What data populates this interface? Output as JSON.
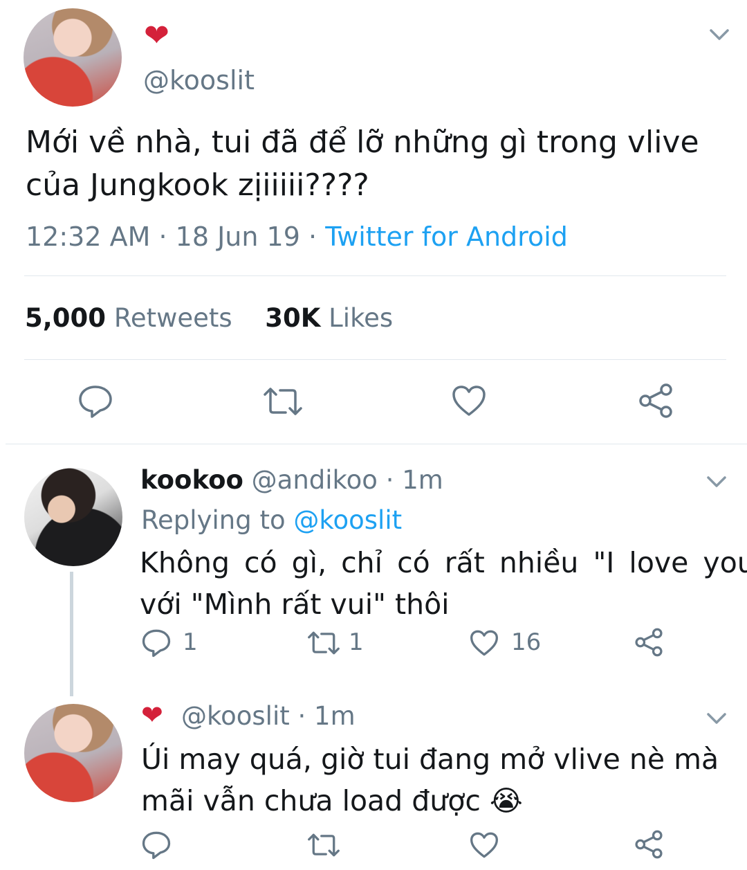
{
  "main_tweet": {
    "handle": "@kooslit",
    "text_line1": "Mới về nhà, tui đã để lỡ những gì trong vlive",
    "text_line2": "của Jungkook zịiiiii????",
    "time": "12:32 AM",
    "sep1": "·",
    "date": "18 Jun 19",
    "sep2": "·",
    "source": "Twitter for Android",
    "retweets_count": "5,000",
    "retweets_label": "Retweets",
    "likes_count": "30K",
    "likes_label": "Likes"
  },
  "reply1": {
    "name": "kookoo",
    "handle": "@andikoo",
    "sep": "·",
    "age": "1m",
    "replying_label": "Replying to",
    "replying_handle": "@kooslit",
    "text_line1": "Không có gì, chỉ có rất nhiều \"I love you\"",
    "text_line2": "với \"Mình rất vui\" thôi",
    "reply_count": "1",
    "retweet_count": "1",
    "like_count": "16"
  },
  "reply2": {
    "handle": "@kooslit",
    "sep": "·",
    "age": "1m",
    "text_line1": "Úi may quá, giờ tui đang mở vlive nè mà",
    "text_line2": "mãi vẫn chưa load được",
    "emoji": "😭"
  },
  "icons": {
    "heart_badge": "❤",
    "chevron": "chevron-down-icon",
    "reply": "reply-icon",
    "retweet": "retweet-icon",
    "like": "like-icon",
    "share": "share-icon"
  },
  "colors": {
    "text": "#14171a",
    "secondary": "#657786",
    "link": "#1da1f2",
    "divider": "#e1e8ed"
  }
}
